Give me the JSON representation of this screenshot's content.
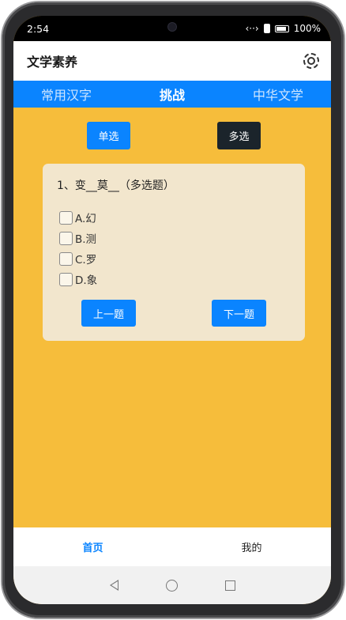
{
  "status_bar": {
    "time": "2:54",
    "signal_text": "‹··›",
    "battery": "100%",
    "icons": [
      "dots-icon",
      "alarm-icon",
      "battery-icon"
    ]
  },
  "header": {
    "title": "文学素养",
    "settings_icon": "settings-icon"
  },
  "tabs": [
    {
      "label": "常用汉字",
      "active": false
    },
    {
      "label": "挑战",
      "active": true
    },
    {
      "label": "中华文学",
      "active": false
    }
  ],
  "mode": {
    "single_label": "单选",
    "multi_label": "多选",
    "selected": "multi"
  },
  "question": {
    "text": "1、变__莫__（多选题）",
    "options": [
      "A.幻",
      "B.测",
      "C.罗",
      "D.象"
    ]
  },
  "navigation": {
    "prev_label": "上一题",
    "next_label": "下一题"
  },
  "bottom_nav": [
    {
      "label": "首页",
      "active": true
    },
    {
      "label": "我的",
      "active": false
    }
  ],
  "colors": {
    "accent": "#0a84ff",
    "background": "#f6bd3b",
    "card": "#f2e6cd",
    "dark_button": "#1b242b"
  }
}
